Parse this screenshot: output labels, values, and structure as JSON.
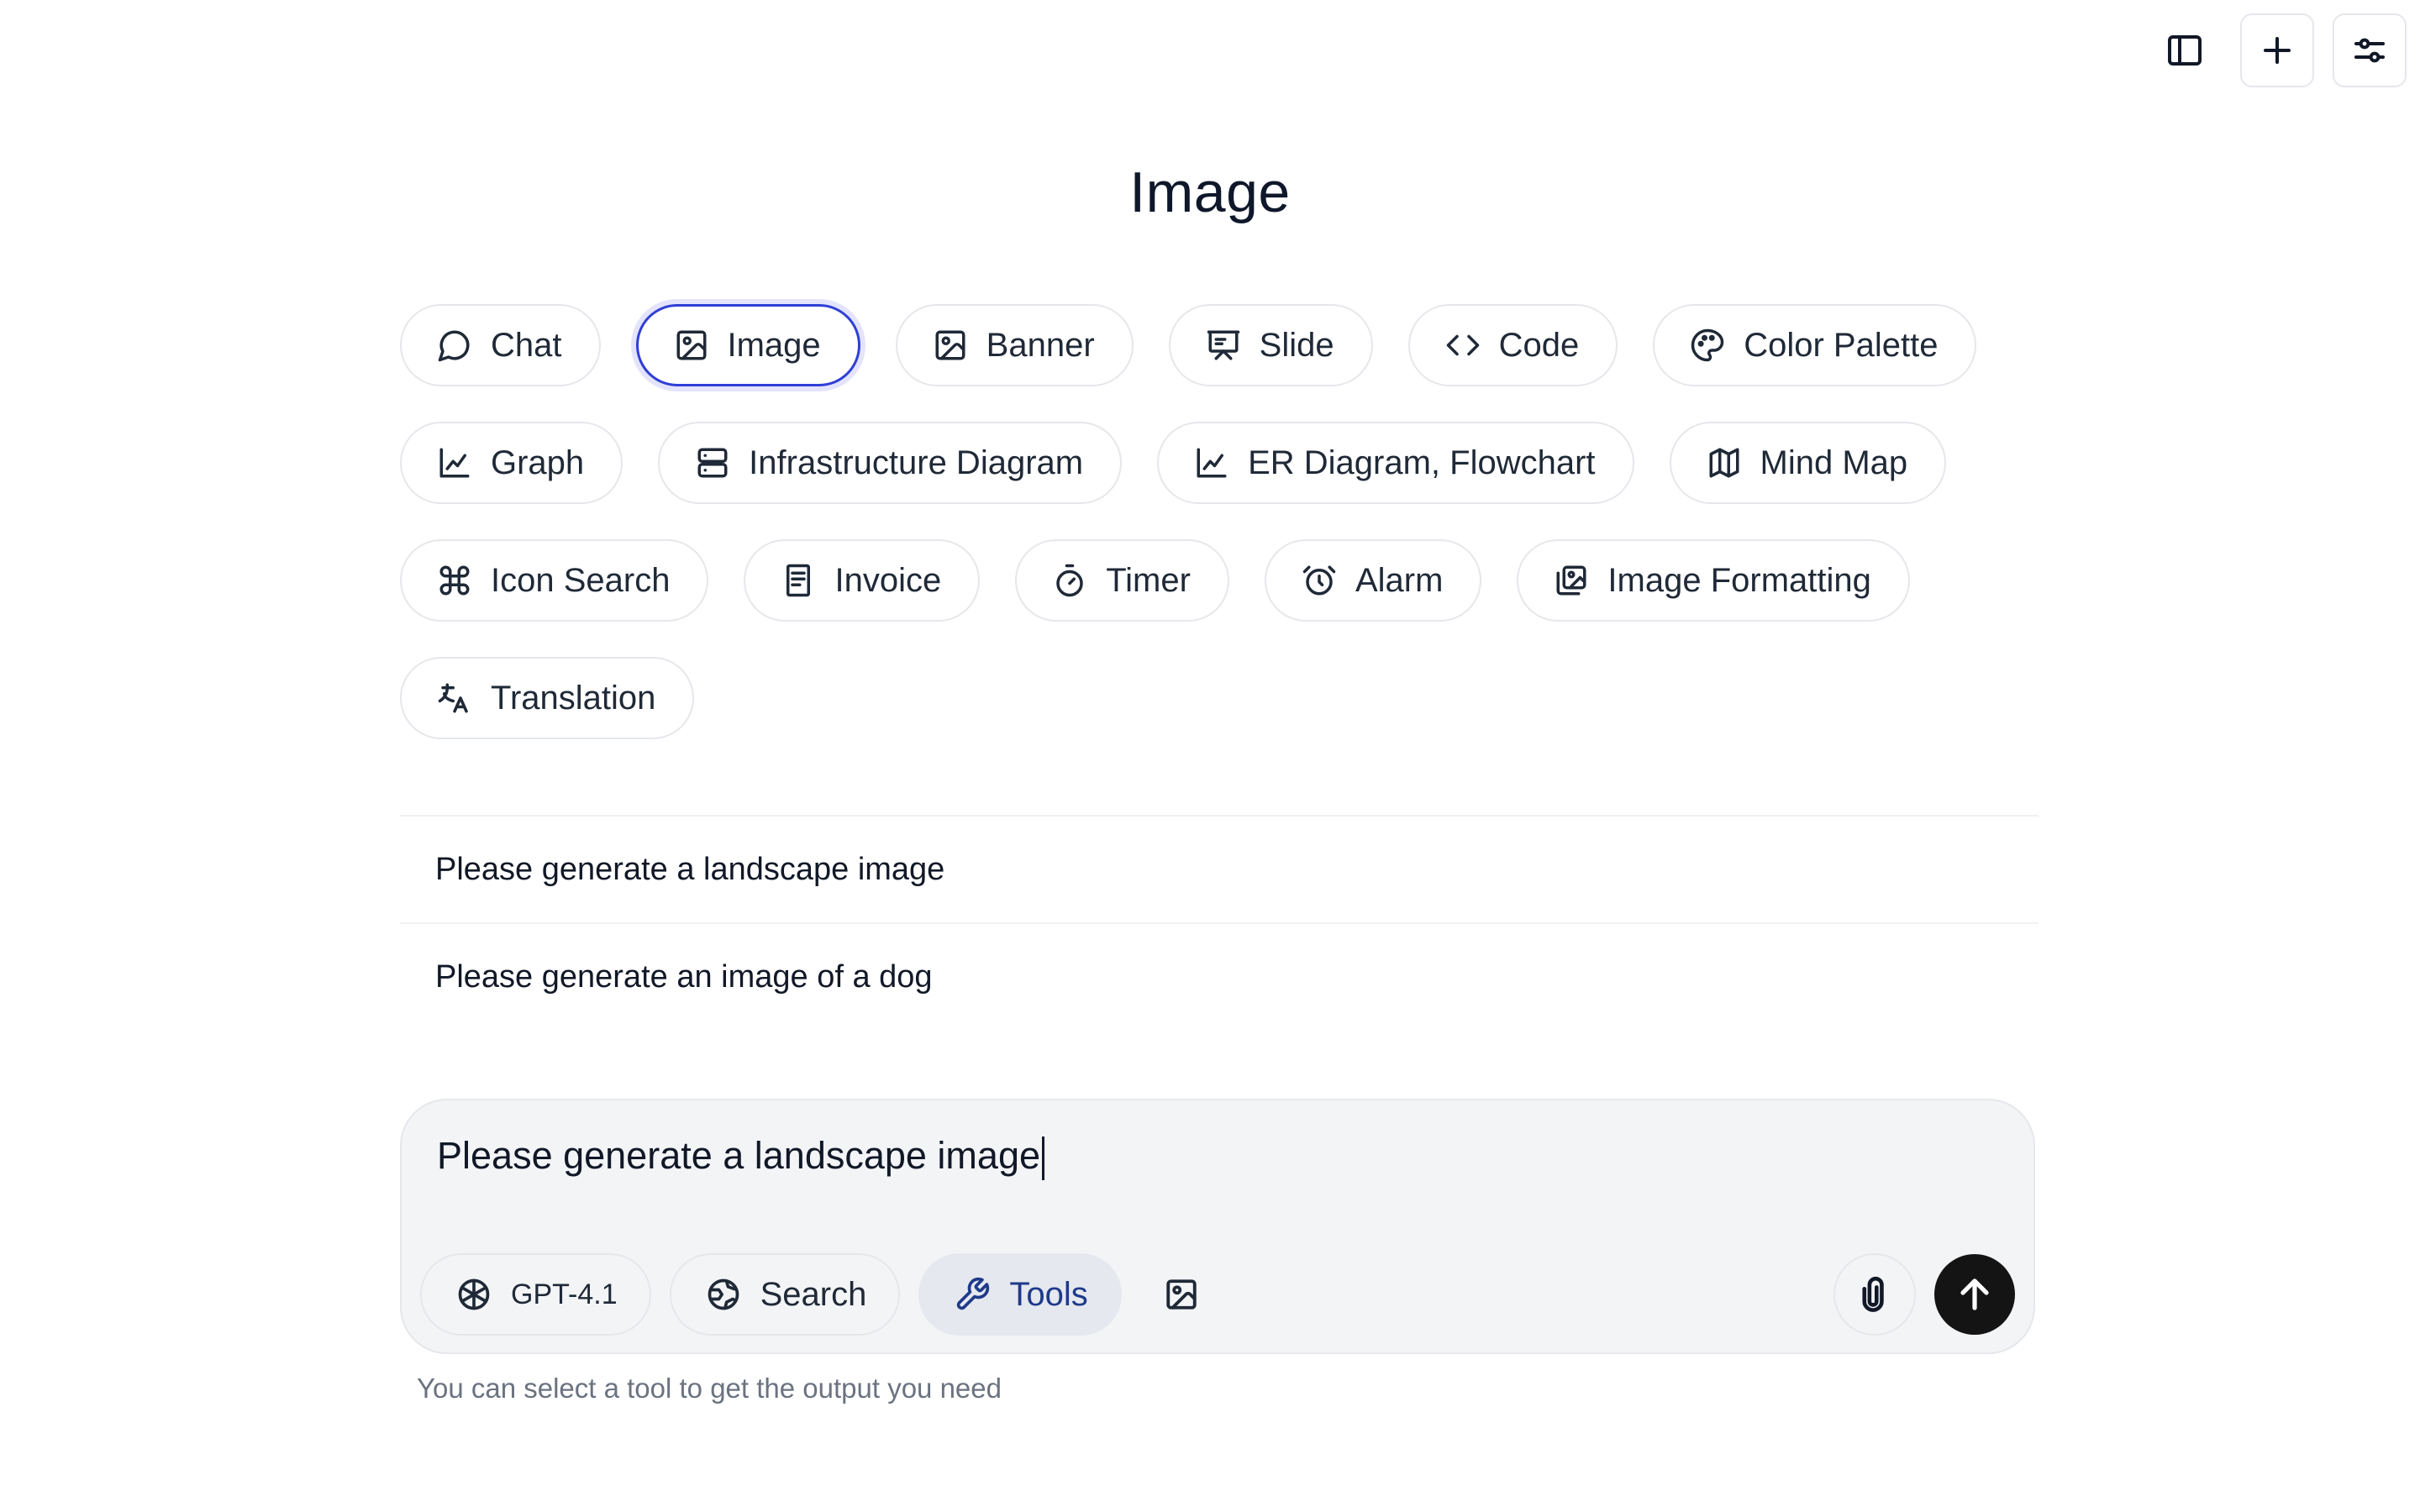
{
  "header": {
    "title": "Image",
    "buttons": [
      {
        "name": "toggle-sidebar-button",
        "icon": "sidebar-icon"
      },
      {
        "name": "new-chat-button",
        "icon": "plus-icon"
      },
      {
        "name": "settings-button",
        "icon": "sliders-icon"
      }
    ]
  },
  "tools": {
    "selected": "Image",
    "rows": [
      [
        {
          "label": "Chat",
          "icon": "chat-bubble-icon"
        },
        {
          "label": "Image",
          "icon": "image-icon"
        },
        {
          "label": "Banner",
          "icon": "image-icon"
        },
        {
          "label": "Slide",
          "icon": "presentation-icon"
        },
        {
          "label": "Code",
          "icon": "code-icon"
        },
        {
          "label": "Color Palette",
          "icon": "palette-icon"
        }
      ],
      [
        {
          "label": "Graph",
          "icon": "chart-line-icon"
        },
        {
          "label": "Infrastructure Diagram",
          "icon": "server-icon"
        },
        {
          "label": "ER Diagram, Flowchart",
          "icon": "chart-line-icon"
        },
        {
          "label": "Mind Map",
          "icon": "map-icon"
        }
      ],
      [
        {
          "label": "Icon Search",
          "icon": "command-icon"
        },
        {
          "label": "Invoice",
          "icon": "receipt-icon"
        },
        {
          "label": "Timer",
          "icon": "timer-icon"
        },
        {
          "label": "Alarm",
          "icon": "alarm-clock-icon"
        },
        {
          "label": "Image Formatting",
          "icon": "images-icon"
        }
      ],
      [
        {
          "label": "Translation",
          "icon": "translate-icon"
        }
      ]
    ]
  },
  "suggestions": [
    "Please generate a landscape image",
    "Please generate an image of a dog"
  ],
  "composer": {
    "value": "Please generate a landscape image",
    "model_label": "GPT-4.1",
    "search_label": "Search",
    "tools_label": "Tools",
    "hint": "You can select a tool to get the output you need"
  },
  "colors": {
    "accent": "#2f3fd6",
    "send_button": "#141414",
    "composer_bg": "#f3f4f6",
    "tools_active_text": "#1e3a8a"
  }
}
